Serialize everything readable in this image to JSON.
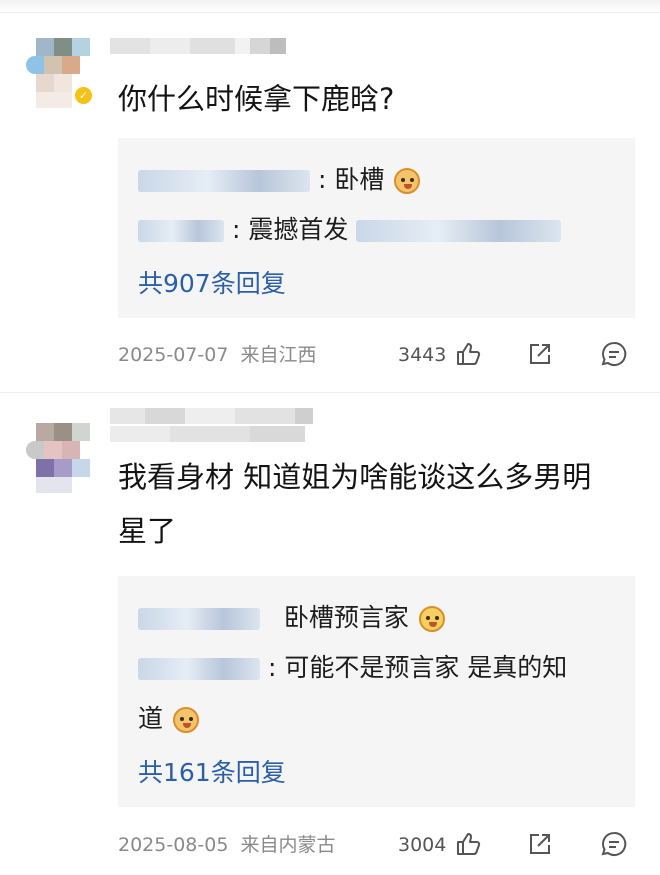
{
  "comments": [
    {
      "text": "你什么时候拿下鹿晗?",
      "replies": [
        {
          "sep": ":",
          "text": "卧槽",
          "emoji": "dog-face-emoji"
        },
        {
          "sep": ":",
          "text": "震撼首发"
        }
      ],
      "more": "共907条回复",
      "date": "2025-07-07",
      "location": "来自江西",
      "likes": "3443"
    },
    {
      "text_line1": "我看身材 知道姐为啥能谈这么多男明",
      "text_line2": "星了",
      "replies": [
        {
          "text": "卧槽预言家",
          "emoji": "praying-face-emoji"
        },
        {
          "sep": ":",
          "text": "可能不是预言家 是真的知",
          "text2": "道",
          "emoji": "dog-face-emoji"
        }
      ],
      "more": "共161条回复",
      "date": "2025-08-05",
      "location": "来自内蒙古",
      "likes": "3004"
    }
  ],
  "icons": {
    "like": "thumbs-up-icon",
    "share": "share-icon",
    "comment": "comment-icon"
  },
  "colors": {
    "link": "#2b5fa8",
    "meta": "#8a8a8a",
    "panel": "#f5f5f5"
  }
}
